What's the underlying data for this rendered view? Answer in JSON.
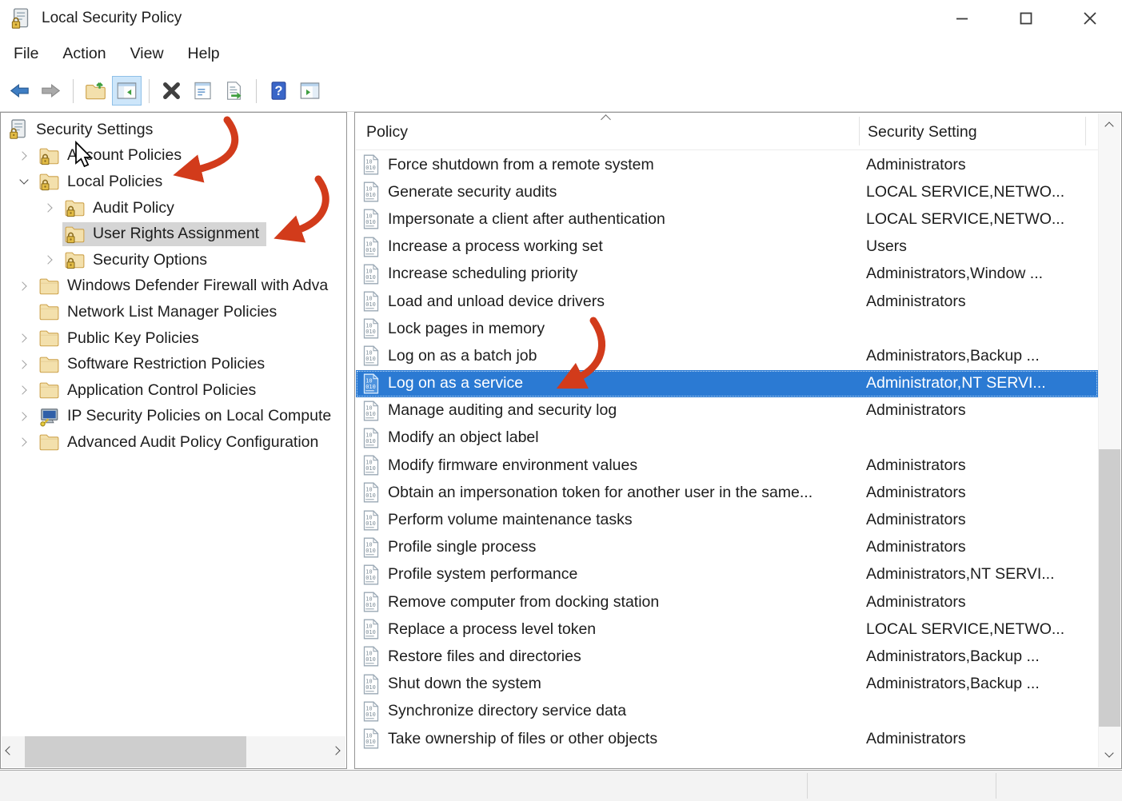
{
  "window": {
    "title": "Local Security Policy",
    "app_icon": "document-lock-icon",
    "controls": [
      "minimize-button",
      "maximize-button",
      "close-button"
    ]
  },
  "menu": {
    "items": [
      "File",
      "Action",
      "View",
      "Help"
    ]
  },
  "toolbar": {
    "icons": [
      "back-icon",
      "forward-icon",
      "up-one-level-icon",
      "show-console-tree-icon",
      "delete-icon",
      "properties-icon",
      "export-list-icon",
      "help-icon",
      "show-action-pane-icon"
    ],
    "active_icon": "show-console-tree-icon"
  },
  "tree": {
    "items": [
      {
        "label": "Security Settings",
        "classes": "lvl0 icon-root exp-none"
      },
      {
        "label": "Account Policies",
        "classes": "lvl1 icon-folder-lock exp-collapsed"
      },
      {
        "label": "Local Policies",
        "classes": "lvl1 icon-folder-lock exp-expanded"
      },
      {
        "label": "Audit Policy",
        "classes": "lvl2 icon-folder-lock exp-collapsed"
      },
      {
        "label": "User Rights Assignment",
        "classes": "lvl2 icon-folder-lock exp-none selected"
      },
      {
        "label": "Security Options",
        "classes": "lvl2 icon-folder-lock exp-collapsed"
      },
      {
        "label": "Windows Defender Firewall with Adva",
        "classes": "lvl1 icon-folder exp-collapsed"
      },
      {
        "label": "Network List Manager Policies",
        "classes": "lvl1 icon-folder exp-none"
      },
      {
        "label": "Public Key Policies",
        "classes": "lvl1 icon-folder exp-collapsed"
      },
      {
        "label": "Software Restriction Policies",
        "classes": "lvl1 icon-folder exp-collapsed"
      },
      {
        "label": "Application Control Policies",
        "classes": "lvl1 icon-folder exp-collapsed"
      },
      {
        "label": "IP Security Policies on Local Compute",
        "classes": "lvl1 icon-computer-key exp-collapsed"
      },
      {
        "label": "Advanced Audit Policy Configuration",
        "classes": "lvl1 icon-folder exp-collapsed"
      }
    ]
  },
  "list": {
    "columns": [
      "Policy",
      "Security Setting"
    ],
    "sort": "ascending",
    "rows": [
      {
        "policy": "Force shutdown from a remote system",
        "setting": "Administrators",
        "classes": ""
      },
      {
        "policy": "Generate security audits",
        "setting": "LOCAL SERVICE,NETWO...",
        "classes": ""
      },
      {
        "policy": "Impersonate a client after authentication",
        "setting": "LOCAL SERVICE,NETWO...",
        "classes": ""
      },
      {
        "policy": "Increase a process working set",
        "setting": "Users",
        "classes": ""
      },
      {
        "policy": "Increase scheduling priority",
        "setting": "Administrators,Window ...",
        "classes": ""
      },
      {
        "policy": "Load and unload device drivers",
        "setting": "Administrators",
        "classes": ""
      },
      {
        "policy": "Lock pages in memory",
        "setting": "",
        "classes": ""
      },
      {
        "policy": "Log on as a batch job",
        "setting": "Administrators,Backup ...",
        "classes": ""
      },
      {
        "policy": "Log on as a service",
        "setting": "Administrator,NT SERVI...",
        "classes": "selected"
      },
      {
        "policy": "Manage auditing and security log",
        "setting": "Administrators",
        "classes": ""
      },
      {
        "policy": "Modify an object label",
        "setting": "",
        "classes": ""
      },
      {
        "policy": "Modify firmware environment values",
        "setting": "Administrators",
        "classes": ""
      },
      {
        "policy": "Obtain an impersonation token for another user in the same...",
        "setting": "Administrators",
        "classes": ""
      },
      {
        "policy": "Perform volume maintenance tasks",
        "setting": "Administrators",
        "classes": ""
      },
      {
        "policy": "Profile single process",
        "setting": "Administrators",
        "classes": ""
      },
      {
        "policy": "Profile system performance",
        "setting": "Administrators,NT SERVI...",
        "classes": ""
      },
      {
        "policy": "Remove computer from docking station",
        "setting": "Administrators",
        "classes": ""
      },
      {
        "policy": "Replace a process level token",
        "setting": "LOCAL SERVICE,NETWO...",
        "classes": ""
      },
      {
        "policy": "Restore files and directories",
        "setting": "Administrators,Backup ...",
        "classes": ""
      },
      {
        "policy": "Shut down the system",
        "setting": "Administrators,Backup ...",
        "classes": ""
      },
      {
        "policy": "Synchronize directory service data",
        "setting": "",
        "classes": ""
      },
      {
        "policy": "Take ownership of files or other objects",
        "setting": "Administrators",
        "classes": ""
      }
    ]
  },
  "annotations": {
    "arrow_color": "#d23b1b",
    "arrows_point_at": [
      "Local Policies",
      "User Rights Assignment",
      "Log on as a service"
    ]
  },
  "colors": {
    "selection_blue": "#2b7ad3",
    "tree_selection_gray": "#d5d5d5",
    "folder_yellow": "#f3e0ac",
    "status_bar": "#f3f3f3"
  }
}
